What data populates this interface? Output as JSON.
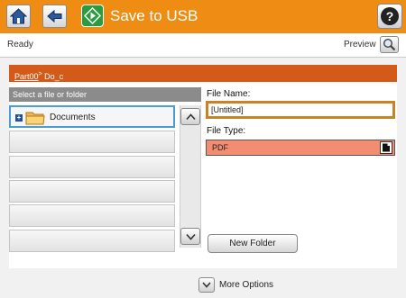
{
  "header": {
    "title": "Save to USB",
    "home_icon": "home-icon",
    "back_icon": "back-icon",
    "start_icon": "start-icon",
    "help_icon": "help-icon",
    "help_glyph": "?",
    "background": "#ee8c14"
  },
  "status": {
    "text": "Ready",
    "preview_label": "Preview",
    "preview_icon": "magnifier-icon"
  },
  "breadcrumb": {
    "root": "Part00",
    "separator": ">",
    "current": "Do_c"
  },
  "file_list": {
    "header": "Select a file or folder",
    "items": [
      {
        "label": "Documents",
        "icon": "folder-icon",
        "expand": "+",
        "selected": true
      }
    ],
    "scroll_up_icon": "chevron-up-icon",
    "scroll_down_icon": "chevron-down-icon"
  },
  "file_name": {
    "label": "File Name:",
    "value": "[Untitled]"
  },
  "file_type": {
    "label": "File Type:",
    "value": "PDF",
    "accent": "#f48c72"
  },
  "new_folder_label": "New Folder",
  "more_options_label": "More Options"
}
